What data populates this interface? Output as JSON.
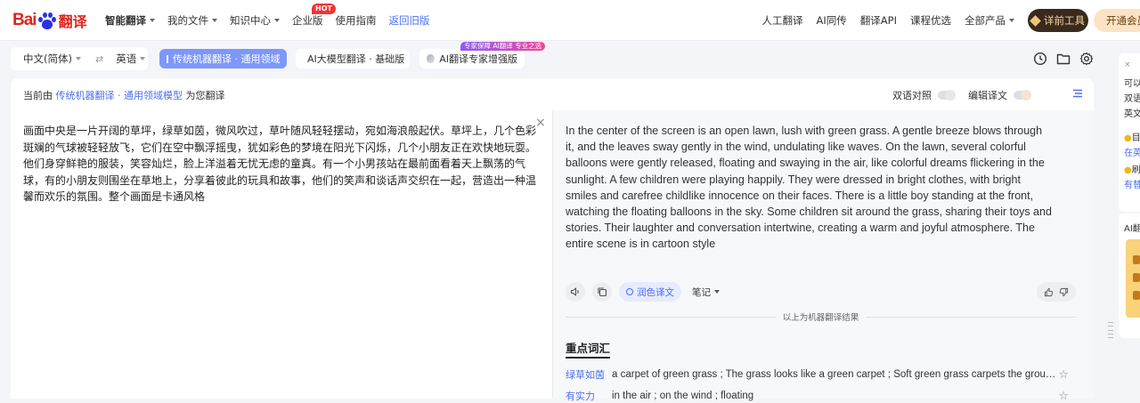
{
  "brand": {
    "logo_prefix": "Bai",
    "logo_du": "du",
    "logo_suffix": "翻译"
  },
  "nav": {
    "items": [
      {
        "label": "智能翻译",
        "caret": true,
        "bold": true
      },
      {
        "label": "我的文件",
        "caret": true
      },
      {
        "label": "知识中心",
        "caret": true
      },
      {
        "label": "企业版",
        "badge": "HOT"
      },
      {
        "label": "使用指南"
      },
      {
        "label": "返回旧版",
        "blue": true
      }
    ],
    "right": [
      "人工翻译",
      "AI同传",
      "翻译API",
      "课程优选",
      "全部产品"
    ],
    "vip_label": "详前工具",
    "open_label": "开通会员"
  },
  "langs": {
    "source": "中文(简体)",
    "target": "英语"
  },
  "modes": {
    "active": "传统机器翻译 · 通用领域",
    "llm": "AI大模型翻译 · 基础版",
    "expert": "AI翻译专家增强版",
    "expert_tag": "专家保障 AI翻译 专业之选"
  },
  "subhead": {
    "prefix": "当前由",
    "link1": "传统机器翻译",
    "sep": " · ",
    "link2": "通用领域模型",
    "suffix": "为您翻译",
    "bilingual": "双语对照",
    "edit": "编辑译文"
  },
  "source_text": "画面中央是一片开阔的草坪，绿草如茵，微风吹过，草叶随风轻轻摆动，宛如海浪般起伏。草坪上，几个色彩斑斓的气球被轻轻放飞，它们在空中飘浮摇曳，犹如彩色的梦境在阳光下闪烁，几个小朋友正在欢快地玩耍。他们身穿鲜艳的服装，笑容灿烂，脸上洋溢着无忧无虑的童真。有一个小男孩站在最前面看着天上飘荡的气球，有的小朋友则围坐在草地上，分享着彼此的玩具和故事，他们的笑声和谈话声交织在一起，营造出一种温馨而欢乐的氛围。整个画面是卡通风格",
  "translation": "In the center of the screen is an open lawn, lush with green grass. A gentle breeze blows through it, and the leaves sway gently in the wind, undulating like waves. On the lawn, several colorful balloons were gently released, floating and swaying in the air, like colorful dreams flickering in the sunlight. A few children were playing happily. They were dressed in bright clothes, with bright smiles and carefree childlike innocence on their faces. There is a little boy standing at the front, watching the floating balloons in the sky. Some children sit around the grass, sharing their toys and stories. Their laughter and conversation intertwine, creating a warm and joyful atmosphere. The entire scene is in cartoon style",
  "actions": {
    "polish": "润色译文",
    "notes": "笔记"
  },
  "end_line": "以上为机器翻译结果",
  "vocab": {
    "title": "重点词汇",
    "items": [
      {
        "word": "绿草如茵",
        "def": "a carpet of green grass ; The grass looks like a green carpet ; Soft green grass carpets the ground ; The grass is lush and green"
      },
      {
        "word": "有实力",
        "def": "in the air ; on the wind ; floating"
      }
    ]
  },
  "side": {
    "card1": [
      "可以",
      "双语",
      "英文",
      "目",
      "在英",
      "刷",
      "有替"
    ],
    "card2_title": "AI翻"
  },
  "colors": {
    "brand_red": "#e1251b",
    "brand_blue": "#2932e1",
    "accent": "#4e6ef2",
    "active_tab": "#7e97fb"
  }
}
